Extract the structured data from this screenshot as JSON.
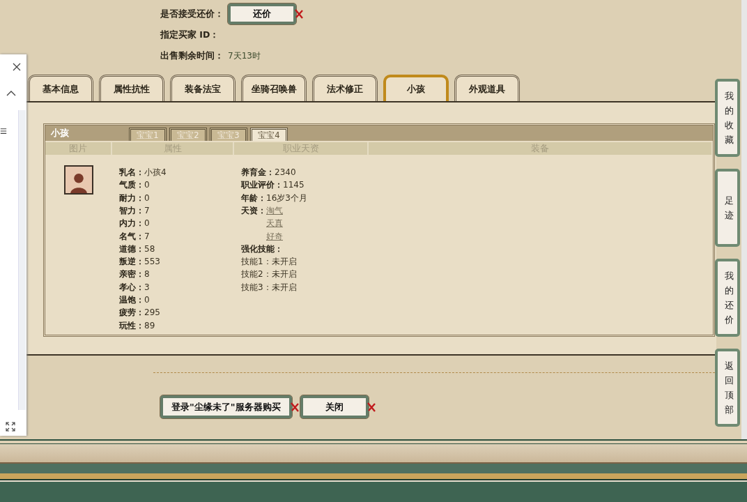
{
  "offer": {
    "accept_label": "是否接受还价：",
    "accept_button": "还价",
    "buyer_label": "指定买家 ID：",
    "time_label": "出售剩余时间：",
    "time_value": "7天13时"
  },
  "tabs": [
    {
      "label": "基本信息",
      "selected": false
    },
    {
      "label": "属性抗性",
      "selected": false
    },
    {
      "label": "装备法宝",
      "selected": false
    },
    {
      "label": "坐骑召唤兽",
      "selected": false
    },
    {
      "label": "法术修正",
      "selected": false
    },
    {
      "label": "小孩",
      "selected": true
    },
    {
      "label": "外观道具",
      "selected": false
    }
  ],
  "child_panel": {
    "title": "小孩",
    "sub_tabs": [
      {
        "label": "宝宝1",
        "selected": false
      },
      {
        "label": "宝宝2",
        "selected": false
      },
      {
        "label": "宝宝3",
        "selected": false
      },
      {
        "label": "宝宝4",
        "selected": true
      }
    ],
    "columns": [
      "图片",
      "属性",
      "职业天资",
      "装备"
    ],
    "attributes": [
      {
        "label": "乳名：",
        "value": "小孩4"
      },
      {
        "label": "气质：",
        "value": "0"
      },
      {
        "label": "耐力：",
        "value": "0"
      },
      {
        "label": "智力：",
        "value": "7"
      },
      {
        "label": "内力：",
        "value": "0"
      },
      {
        "label": "名气：",
        "value": "7"
      },
      {
        "label": "道德：",
        "value": "58"
      },
      {
        "label": "叛逆：",
        "value": "553"
      },
      {
        "label": "亲密：",
        "value": "8"
      },
      {
        "label": "孝心：",
        "value": "3"
      },
      {
        "label": "温饱：",
        "value": "0"
      },
      {
        "label": "疲劳：",
        "value": "295"
      },
      {
        "label": "玩性：",
        "value": "89"
      }
    ],
    "career": [
      {
        "label": "养育金：",
        "value": "2340"
      },
      {
        "label": "职业评价：",
        "value": "1145"
      },
      {
        "label": "年龄：",
        "value": "16岁3个月"
      }
    ],
    "talent_label": "天资：",
    "talents": [
      "淘气",
      "天真",
      "好奇"
    ],
    "skills_heading": "强化技能：",
    "skills": [
      {
        "label": "技能1：",
        "value": "未开启"
      },
      {
        "label": "技能2：",
        "value": "未开启"
      },
      {
        "label": "技能3：",
        "value": "未开启"
      }
    ]
  },
  "buttons": [
    "登录\"尘缘未了\"服务器购买",
    "关闭"
  ],
  "side_buttons": [
    "我的收藏",
    "足迹",
    "我的还价",
    "返回顶部"
  ]
}
